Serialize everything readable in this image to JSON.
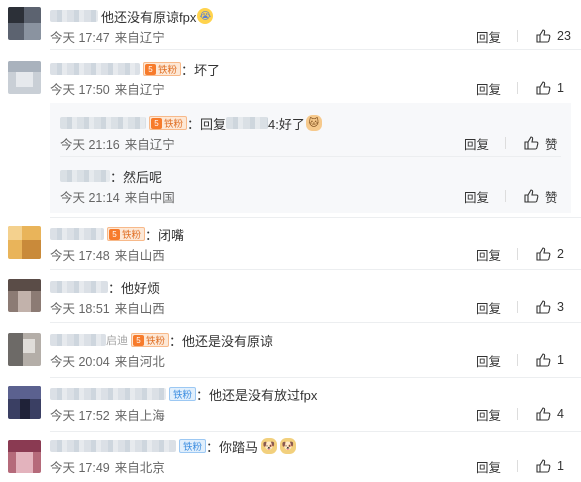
{
  "common": {
    "reply": "回复",
    "like": "赞",
    "fan_badge": "铁粉",
    "fan_level": "5"
  },
  "comments": [
    {
      "text": "他还没有原谅fpx",
      "emoji": "crying-face",
      "time": "今天 17:47",
      "loc": "来自辽宁",
      "likes": "23"
    },
    {
      "text": "：坏了",
      "time": "今天 17:50",
      "loc": "来自辽宁",
      "likes": "1",
      "replies": [
        {
          "prefix": "：回复",
          "suffix": "4:好了",
          "emoji": "cat",
          "time": "今天 21:16",
          "loc": "来自辽宁"
        },
        {
          "text": "：然后呢",
          "time": "今天 21:14",
          "loc": "来自中国"
        }
      ]
    },
    {
      "text": "：闭嘴",
      "time": "今天 17:48",
      "loc": "来自山西",
      "likes": "2"
    },
    {
      "text": "：他好烦",
      "time": "今天 18:51",
      "loc": "来自山西",
      "likes": "3"
    },
    {
      "name_tail": "启迪",
      "text": "：他还是没有原谅",
      "time": "今天 20:04",
      "loc": "来自河北",
      "likes": "1"
    },
    {
      "text": "：他还是没有放过fpx",
      "time": "今天 17:52",
      "loc": "来自上海",
      "likes": "4"
    },
    {
      "text": "：你踏马",
      "emoji": "dog",
      "time": "今天 17:49",
      "loc": "来自北京",
      "likes": "1"
    }
  ],
  "colors": {
    "fan_orange": "#f77b2b",
    "fan_blue": "#5aa7f0",
    "reply_bg": "#f7f8fa"
  },
  "icons": {
    "like": "thumbs-up-icon"
  }
}
